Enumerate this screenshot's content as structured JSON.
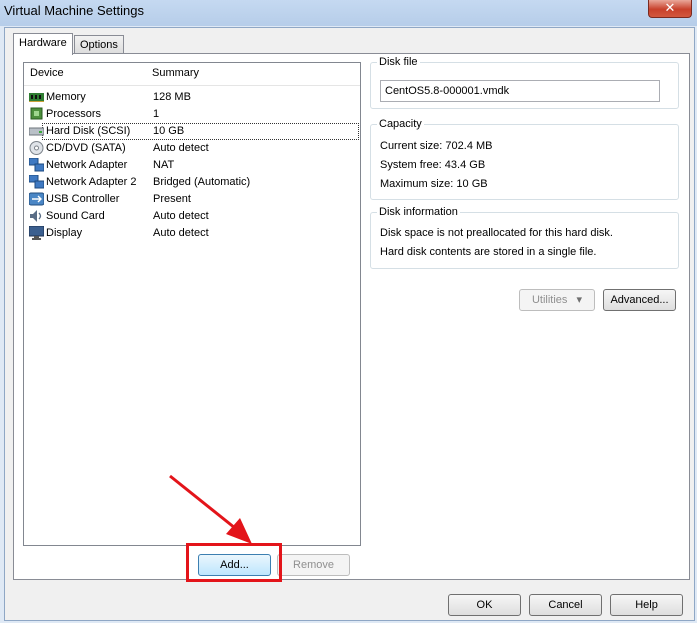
{
  "window": {
    "title": "Virtual Machine Settings",
    "close_glyph": "✕"
  },
  "tabs": [
    {
      "label": "Hardware"
    },
    {
      "label": "Options"
    }
  ],
  "device_list": {
    "headers": {
      "device": "Device",
      "summary": "Summary"
    },
    "rows": [
      {
        "device": "Memory",
        "summary": "128 MB",
        "icon": "memory-icon"
      },
      {
        "device": "Processors",
        "summary": "1",
        "icon": "processor-icon"
      },
      {
        "device": "Hard Disk (SCSI)",
        "summary": "10 GB",
        "icon": "hard-disk-icon",
        "selected": true
      },
      {
        "device": "CD/DVD (SATA)",
        "summary": "Auto detect",
        "icon": "cd-dvd-icon"
      },
      {
        "device": "Network Adapter",
        "summary": "NAT",
        "icon": "network-adapter-icon"
      },
      {
        "device": "Network Adapter 2",
        "summary": "Bridged (Automatic)",
        "icon": "network-adapter-icon"
      },
      {
        "device": "USB Controller",
        "summary": "Present",
        "icon": "usb-icon"
      },
      {
        "device": "Sound Card",
        "summary": "Auto detect",
        "icon": "sound-card-icon"
      },
      {
        "device": "Display",
        "summary": "Auto detect",
        "icon": "display-icon"
      }
    ]
  },
  "list_buttons": {
    "add": "Add...",
    "remove": "Remove"
  },
  "disk_file": {
    "title": "Disk file",
    "value": "CentOS5.8-000001.vmdk"
  },
  "capacity": {
    "title": "Capacity",
    "current_size": "Current size:  702.4 MB",
    "system_free": "System free:  43.4 GB",
    "maximum_size": "Maximum size:  10 GB"
  },
  "disk_information": {
    "title": "Disk information",
    "line1": "Disk space is not preallocated for this hard disk.",
    "line2": "Hard disk contents are stored in a single file."
  },
  "disk_buttons": {
    "utilities": "Utilities",
    "advanced": "Advanced..."
  },
  "dialog_buttons": {
    "ok": "OK",
    "cancel": "Cancel",
    "help": "Help"
  },
  "colors": {
    "annotation_red": "#e3141a",
    "title_bar": "#c5d9f1"
  }
}
